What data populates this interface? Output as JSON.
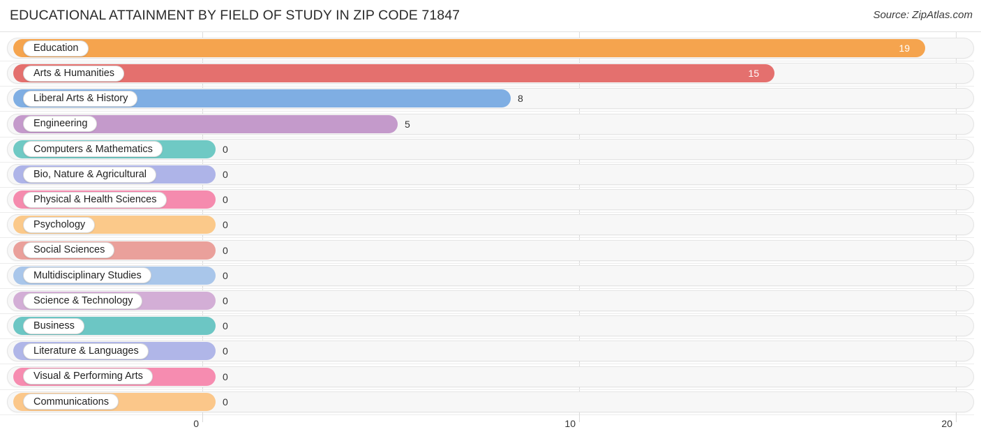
{
  "header": {
    "title": "EDUCATIONAL ATTAINMENT BY FIELD OF STUDY IN ZIP CODE 71847",
    "source": "Source: ZipAtlas.com"
  },
  "chart_data": {
    "type": "bar",
    "orientation": "horizontal",
    "title": "EDUCATIONAL ATTAINMENT BY FIELD OF STUDY IN ZIP CODE 71847",
    "xlabel": "",
    "ylabel": "",
    "xlim": [
      0,
      20
    ],
    "xticks": [
      0,
      10,
      20
    ],
    "xtick_labels": [
      "0",
      "10",
      "20"
    ],
    "grid": true,
    "legend": false,
    "categories": [
      "Education",
      "Arts & Humanities",
      "Liberal Arts & History",
      "Engineering",
      "Computers & Mathematics",
      "Bio, Nature & Agricultural",
      "Physical & Health Sciences",
      "Psychology",
      "Social Sciences",
      "Multidisciplinary Studies",
      "Science & Technology",
      "Business",
      "Literature & Languages",
      "Visual & Performing Arts",
      "Communications"
    ],
    "values": [
      19,
      15,
      8,
      5,
      0,
      0,
      0,
      0,
      0,
      0,
      0,
      0,
      0,
      0,
      0
    ],
    "value_labels": [
      "19",
      "15",
      "8",
      "5",
      "0",
      "0",
      "0",
      "0",
      "0",
      "0",
      "0",
      "0",
      "0",
      "0",
      "0"
    ],
    "colors": [
      "#f5a44e",
      "#e4706e",
      "#7faee3",
      "#c49acb",
      "#6fc9c4",
      "#aeb4e8",
      "#f58bae",
      "#fbc98a",
      "#eaa09b",
      "#a9c6ea",
      "#d3aed6",
      "#6cc6c4",
      "#b0b6e8",
      "#f68cb0",
      "#fbc78a"
    ]
  },
  "rows": [
    {
      "label": "Education",
      "value_label": "19",
      "value": 19,
      "color": "#f5a44e",
      "inside": true
    },
    {
      "label": "Arts & Humanities",
      "value_label": "15",
      "value": 15,
      "color": "#e4706e",
      "inside": true
    },
    {
      "label": "Liberal Arts & History",
      "value_label": "8",
      "value": 8,
      "color": "#7faee3",
      "inside": false
    },
    {
      "label": "Engineering",
      "value_label": "5",
      "value": 5,
      "color": "#c49acb",
      "inside": false
    },
    {
      "label": "Computers & Mathematics",
      "value_label": "0",
      "value": 0,
      "color": "#6fc9c4",
      "inside": false
    },
    {
      "label": "Bio, Nature & Agricultural",
      "value_label": "0",
      "value": 0,
      "color": "#aeb4e8",
      "inside": false
    },
    {
      "label": "Physical & Health Sciences",
      "value_label": "0",
      "value": 0,
      "color": "#f58bae",
      "inside": false
    },
    {
      "label": "Psychology",
      "value_label": "0",
      "value": 0,
      "color": "#fbc98a",
      "inside": false
    },
    {
      "label": "Social Sciences",
      "value_label": "0",
      "value": 0,
      "color": "#eaa09b",
      "inside": false
    },
    {
      "label": "Multidisciplinary Studies",
      "value_label": "0",
      "value": 0,
      "color": "#a9c6ea",
      "inside": false
    },
    {
      "label": "Science & Technology",
      "value_label": "0",
      "value": 0,
      "color": "#d3aed6",
      "inside": false
    },
    {
      "label": "Business",
      "value_label": "0",
      "value": 0,
      "color": "#6cc6c4",
      "inside": false
    },
    {
      "label": "Literature & Languages",
      "value_label": "0",
      "value": 0,
      "color": "#b0b6e8",
      "inside": false
    },
    {
      "label": "Visual & Performing Arts",
      "value_label": "0",
      "value": 0,
      "color": "#f68cb0",
      "inside": false
    },
    {
      "label": "Communications",
      "value_label": "0",
      "value": 0,
      "color": "#fbc78a",
      "inside": false
    }
  ],
  "axis": {
    "ticks": [
      {
        "label": "0",
        "value": 0
      },
      {
        "label": "10",
        "value": 10
      },
      {
        "label": "20",
        "value": 20
      }
    ]
  }
}
